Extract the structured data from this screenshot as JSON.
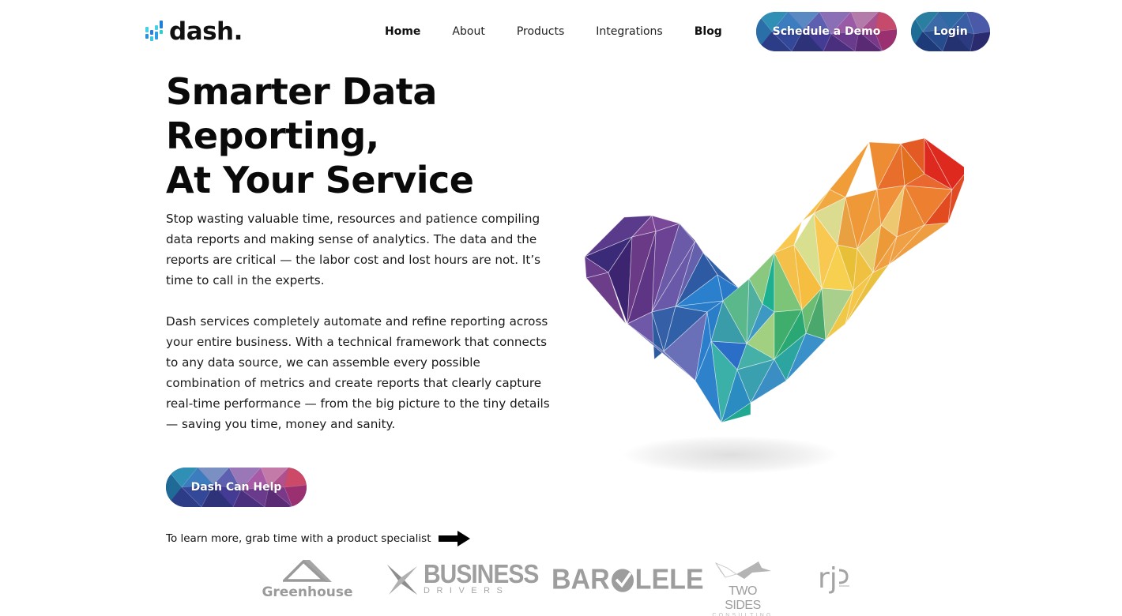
{
  "brand": {
    "name": "dash.",
    "logo_icon": "bar-equalizer-icon",
    "accent_colors": [
      "#3ec7e3",
      "#2a8fe0",
      "#1e5fc8",
      "#27d3c9"
    ]
  },
  "nav": {
    "items": [
      {
        "label": "Home",
        "bold": true
      },
      {
        "label": "About",
        "bold": false
      },
      {
        "label": "Products",
        "bold": false
      },
      {
        "label": "Integrations",
        "bold": false
      },
      {
        "label": "Blog",
        "bold": true
      }
    ],
    "schedule_demo_label": "Schedule a Demo",
    "login_label": "Login"
  },
  "hero": {
    "title_lines": [
      "Smarter Data",
      "Reporting,",
      "At Your Service"
    ],
    "paragraph1": "Stop wasting valuable time, resources and patience compiling data reports and making sense of analytics. The data and the reports are critical — the labor cost and lost hours are not. It’s time to call in the experts.",
    "paragraph2": "Dash services completely automate and refine reporting across your entire business. With a technical framework that connects to any data source, we can assemble every possible combination of metrics and create reports that clearly capture real-time performance — from the big picture to the tiny details — saving you time, money and sanity.",
    "cta_button_label": "Dash Can Help",
    "cta_text": "To learn more, grab time with a product specialist",
    "cta_arrow_icon": "arrow-right-icon",
    "illustration": "polygon-checkmark-icon"
  },
  "clients": {
    "greenhouse": "Greenhouse",
    "business_drivers": {
      "top": "BUSINESS",
      "bottom": "DRIVERS"
    },
    "barolele": {
      "left": "BAR",
      "right": "LELE"
    },
    "two_sides": {
      "top": "TWO SIDES",
      "bottom": "CONSULTING"
    },
    "rjp": "rj"
  },
  "colors": {
    "button_gradient": [
      "#2a8fb8",
      "#3d4fa0",
      "#6a3f96",
      "#a84a8a",
      "#c24a6e"
    ],
    "text": "#111111",
    "logo_gray": "#9a9a9a"
  }
}
